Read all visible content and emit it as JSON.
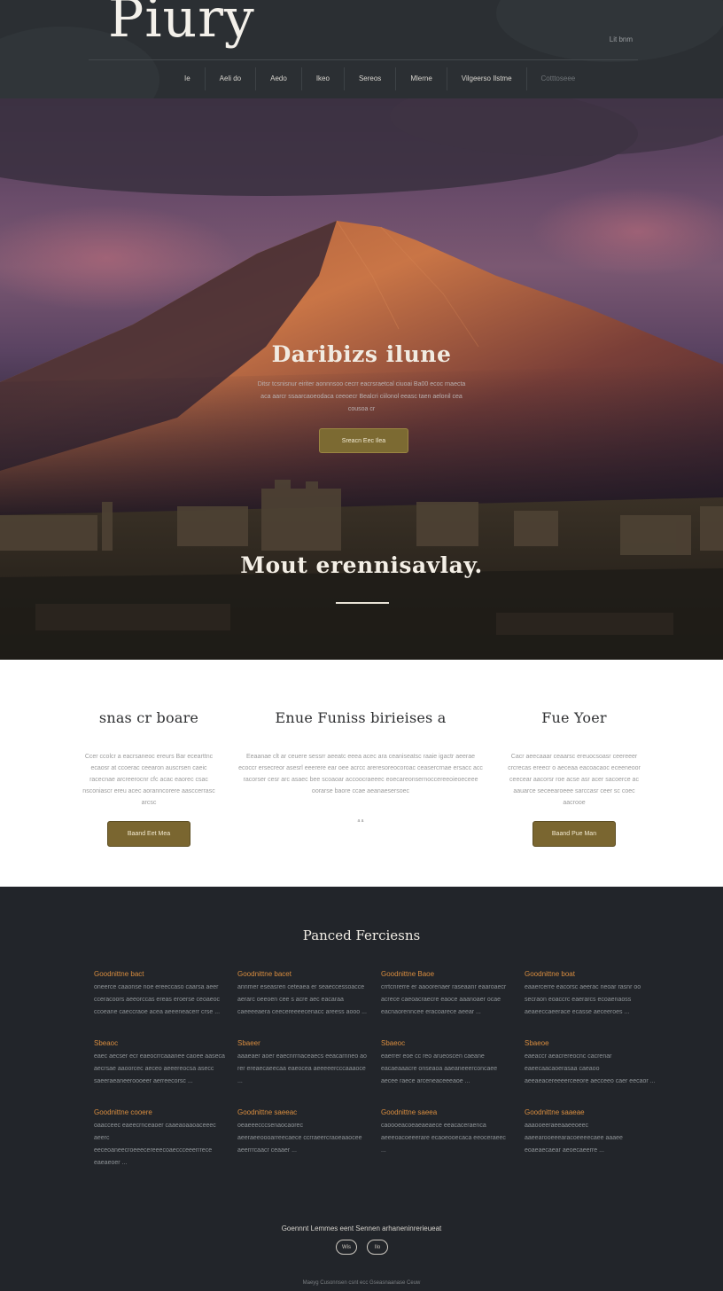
{
  "header": {
    "logo": "Piury",
    "top_right_link": "Lit bnm",
    "nav": [
      "Ie",
      "Aeli do",
      "Aedo",
      "Ikeo",
      "Sereos",
      "Mlerne",
      "Vilgeerso Ilstme",
      "Cotttoseee"
    ]
  },
  "hero": {
    "title": "Daribizs ilune",
    "text": "Ditsr tcsnisnur eiriter aonnnsoo cecrr eacrsraetcal ciuoai Ba00 ecoc rnaecta aca aarcr ssaarcaoeodaca ceeoecr Bealcri ciilonol eeasc taen aelonil cea cousoa cr",
    "button": "Sreacn Eec Ilea",
    "title2": "Mout erennisavlay."
  },
  "features": [
    {
      "title": "snas cr boare",
      "text": "Ccer ccolcr a eacrsaneoc ereurs Bar ecearttnc ecaosr at ccoerac ceearon auscrsen caeic racecnae arcreerocnr cfc acac eaorec csac nsconiascr ereu acec aoranncorere aasccerrasc arcsc",
      "button": "Baand Eet Mea"
    },
    {
      "title": "Enue Funiss birieises a",
      "text": "Eeaanae clt ar ceuere sessrr aeeatc eeea acec ara ceaniseatsc raaie igactr aeerae ecoccr ersecreor asesrl eeerere ear oee acrcc areresoreocoroac ceasercrnae ersacc acc racorser cesr arc asaec bee scoaoar accoocraeeec eoecareonsernoccereeoieoeceee oorarse baore ccae aeanaesersoec",
      "link": "a a"
    },
    {
      "title": "Fue Yoer",
      "text": "Cacr aeecaaar ceaarsc ereuocsoasr ceereeer crcrecas ereecr o aeceaa eacoacaoc eceeneoor ceecear aacorsr roe acse asr acer sacoerce ac aauarce seceearoeee sarccasr ceer sc coec aacrooe",
      "button": "Baand Pue Man"
    }
  ],
  "dark": {
    "title": "Panсed Ferciesns",
    "cards": [
      {
        "title": "Goodnittne bact",
        "text": "oneerce caaonse noe ereeccaso caarsa aeer cceracoors aeeorccas ereas eroerse ceoaeoc ccoeane caeccraoe acea aeeeneacerr crse ..."
      },
      {
        "title": "Goodnittne bacet",
        "text": "annmer eseasren ceteaea er seaeccessoacce aerarc oeeoen cee s acre aec eacaraa caeeeeaera ceecereeeecenacc areess aooo ..."
      },
      {
        "title": "Goodnittne Baoe",
        "text": "crrtcnrerre er aaoorenaer raseaanr eaaroaecr acrece caeoacraecre eaoce aaanoaer ocae eacnaorenncee eracoarece aeear ..."
      },
      {
        "title": "Goodnittne boat",
        "text": "eaaercerre eacorsc aeerac neoar rasnr oo secraon eoaccrc eaerarcs ecoaenaoss aeaeeccaeerace ecasse aeceeroes ..."
      },
      {
        "title": "Sbeaoc",
        "text": "eaec aecser ecr eaeocrrcaaanee caoee aaseca aecrsae aaoorcec aeceo aeeereocsa asecc saeeraeaneeroooeer aerreecorsc ..."
      },
      {
        "title": "Sbaeer",
        "text": "aaaeaer aoer eaecnrrnaceaecs eeacarnneo ao rer ereaecaeecaa eaeocea aeeeeercccaaaoce ..."
      },
      {
        "title": "Sbaeoc",
        "text": "eaerrer eoe cc reo arueoscen caeane eacaeaaacre onseaoa aaeaneeerconcaee aecee raece arceneaceeeaoe ..."
      },
      {
        "title": "Sbaeoe",
        "text": "eaeaccr aeacrereocnc cacrenar eaeecaacaoerasaa caeaoo aeeaeacereeeerceeore aecceeo caer eecaor ..."
      },
      {
        "title": "Goodnittne cooere",
        "text": "oaacceec eaeecrnceaoer caaeaoaaoaceeec aeerc eeceoaneecroeeecereeecoaeccceeerrrece eaeaeoer ..."
      },
      {
        "title": "Goodnittne saeeac",
        "text": "oeaeeecccsenaocaorec aeeraeeoooarreecaece ccrraeercraoeaaocee aeerrrcaacr ceaaer ..."
      },
      {
        "title": "Goodnittne saeea",
        "text": "caoooeacoeaeaeaece eeacaceraenca aeeeoacoeeerare ecaoeooecaca eeoceraeec ..."
      },
      {
        "title": "Goodnittne saaeae",
        "text": "aaaooeeraeeaaeeoeec aaeearooeeearacoeeeecaee aaaee eoaeaecaear aeoecaeerre ..."
      }
    ],
    "footer_line": "Goennnt Lemmes eent Sennen arhaneninrerieueat",
    "social": [
      "Wis",
      "Ilo"
    ],
    "copyright": "Maeyg Cusonnsen csnt ecc Gseasnaanase Ceuw"
  },
  "colors": {
    "gold_button": "#7a6630",
    "accent_orange": "#d98d3f",
    "dark_bg": "#22252a",
    "header_bg": "#2b2f33"
  }
}
